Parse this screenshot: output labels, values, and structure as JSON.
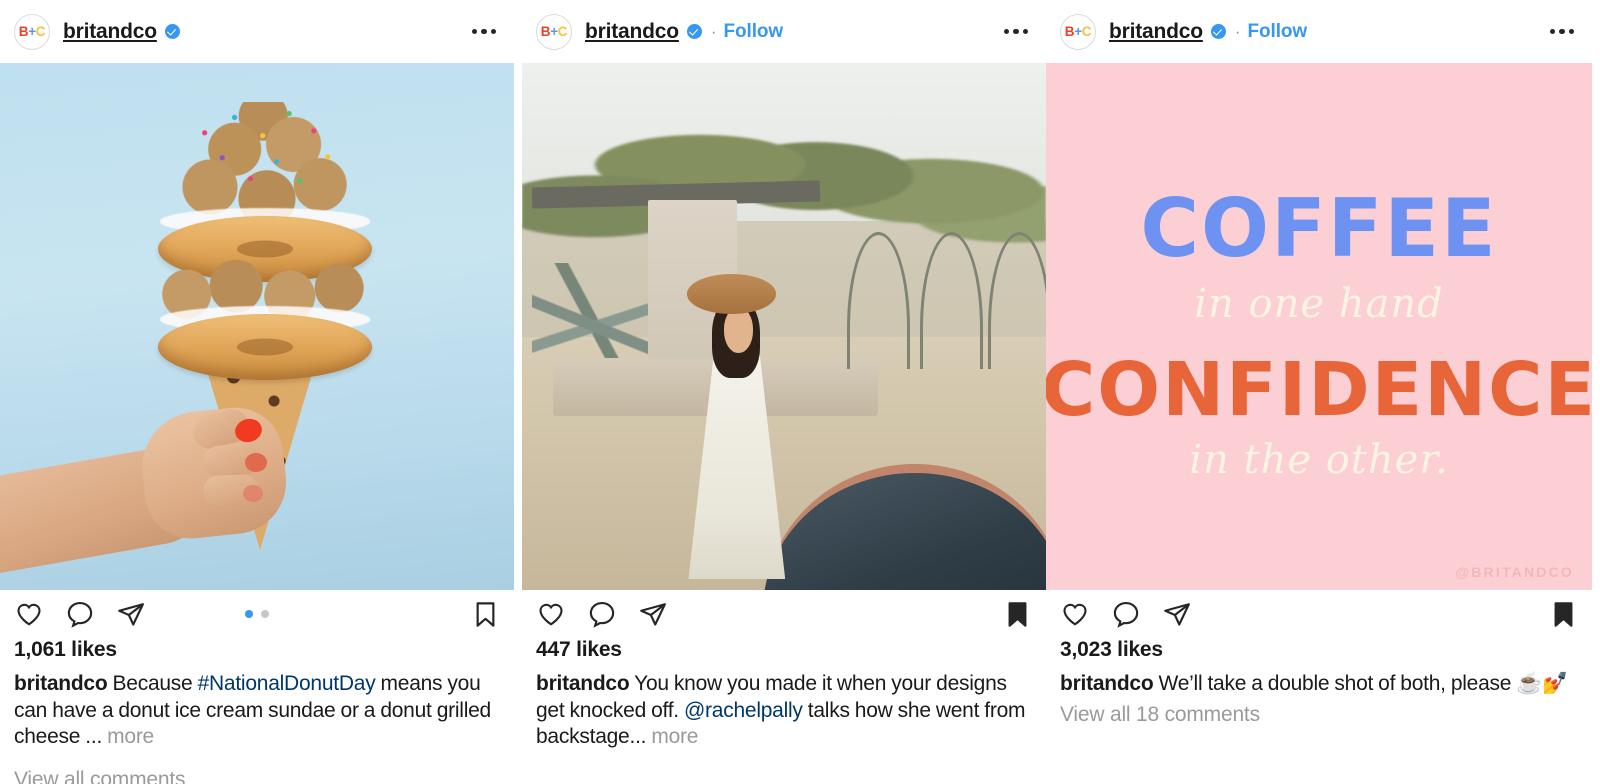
{
  "app": "instagram-feed",
  "colors": {
    "accent_blue": "#3897F0",
    "link_dark_blue": "#00376B",
    "muted_gray": "#9a9a9a",
    "text": "#1a1a1a",
    "quote_bg_pink": "#FBCFD3",
    "quote_blue": "#6E92F2",
    "quote_orange": "#E8653A",
    "quote_cream": "#FCF4E2"
  },
  "avatar": {
    "b": "B",
    "plus": "+",
    "c": "C"
  },
  "posts": [
    {
      "id": "post-donut",
      "username": "britandco",
      "verified": true,
      "show_follow": false,
      "follow_label": "",
      "separator": "·",
      "likes": "1,061 likes",
      "caption": {
        "user": "britandco",
        "pre": "Because ",
        "link": "#NationalDonutDay",
        "post": " means you can have a donut ice cream sundae or a donut grilled cheese ... ",
        "more": "more"
      },
      "view_comments": "View all comments",
      "saved": false,
      "carousel": {
        "count": 2,
        "active": 0
      },
      "image": {
        "alt": "hand holding a donut ice cream cone with sprinkles on light blue background",
        "bg_color": "#bfe0ef"
      }
    },
    {
      "id": "post-garden",
      "username": "britandco",
      "verified": true,
      "show_follow": true,
      "follow_label": "Follow",
      "separator": "·",
      "likes": "447 likes",
      "caption": {
        "user": "britandco",
        "pre": "You know you made it when your designs get knocked off. ",
        "link": "@rachelpally",
        "post": " talks how she went from backstage... ",
        "more": "more"
      },
      "view_comments": "",
      "saved": true,
      "carousel": {
        "count": 0,
        "active": 0
      },
      "image": {
        "alt": "woman in white dress and tan hat standing in a garden by a fountain",
        "bg_color": "#cfc8b4"
      }
    },
    {
      "id": "post-quote",
      "username": "britandco",
      "verified": true,
      "show_follow": true,
      "follow_label": "Follow",
      "separator": "·",
      "likes": "3,023 likes",
      "caption": {
        "user": "britandco",
        "pre": "We’ll take a double shot of both, please ☕💅",
        "link": "",
        "post": "",
        "more": ""
      },
      "view_comments": "View all 18 comments",
      "saved": true,
      "carousel": {
        "count": 0,
        "active": 0
      },
      "image": {
        "alt": "pink quote card",
        "bg_color": "#FBCFD3",
        "quote_line1": "COFFEE",
        "quote_line2": "in one hand",
        "quote_line3": "CONFIDENCE",
        "quote_line4": "in the other.",
        "watermark": "@BRITANDCO"
      }
    }
  ],
  "icons": {
    "like": "heart-icon",
    "comment": "comment-icon",
    "share": "share-icon",
    "save": "bookmark-icon",
    "menu": "more-options-icon",
    "verified": "verified-badge-icon"
  }
}
